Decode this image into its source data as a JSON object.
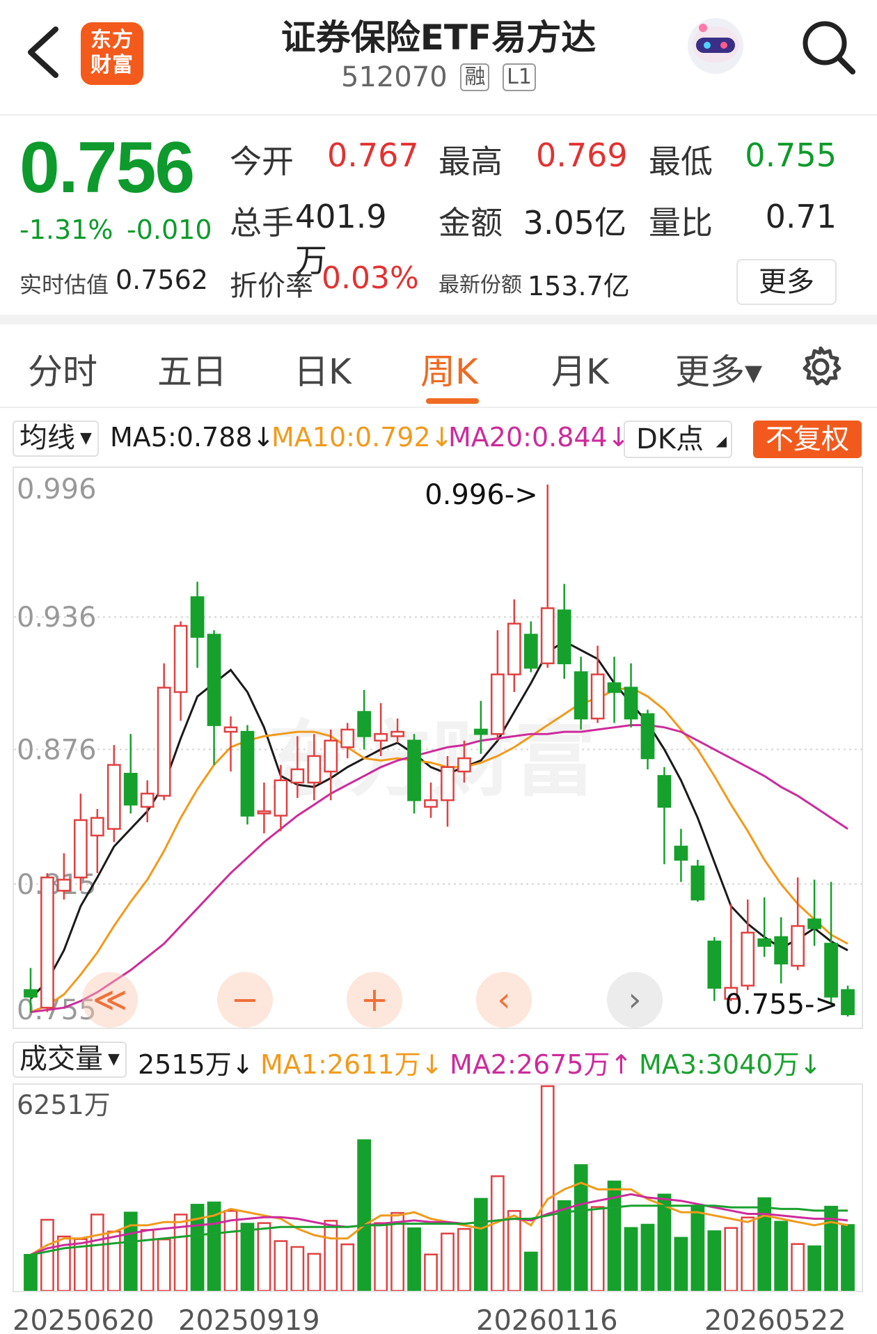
{
  "header": {
    "logo_text_line1": "东方",
    "logo_text_line2": "财富",
    "title": "证券保险ETF易方达",
    "code": "512070",
    "tag_margin": "融",
    "tag_level": "L1"
  },
  "quote": {
    "price": "0.756",
    "change_pct": "-1.31%",
    "change_abs": "-0.010",
    "open_label": "今开",
    "open": "0.767",
    "high_label": "最高",
    "high": "0.769",
    "low_label": "最低",
    "low": "0.755",
    "volume_label": "总手",
    "volume": "401.9万",
    "amount_label": "金额",
    "amount": "3.05亿",
    "vol_ratio_label": "量比",
    "vol_ratio": "0.71",
    "iopv_label": "实时估值",
    "iopv": "0.7562",
    "discount_label": "折价率",
    "discount": "0.03%",
    "shares_label": "最新份额",
    "shares": "153.7亿",
    "more_label": "更多"
  },
  "tabs": {
    "items": [
      "分时",
      "五日",
      "日K",
      "周K",
      "月K",
      "更多▾"
    ],
    "active": "周K"
  },
  "ma_bar": {
    "selector": "均线",
    "ma5": "MA5:0.788↓",
    "ma10": "MA10:0.792↓",
    "ma20": "MA20:0.844↓",
    "dk": "DK点",
    "fq": "不复权",
    "colors": {
      "ma5": "#1a1a1a",
      "ma10": "#f19a1b",
      "ma20": "#cc2b9b"
    }
  },
  "vol_bar": {
    "selector": "成交量",
    "vol": "2515万↓",
    "ma1": "MA1:2611万↓",
    "ma2": "MA2:2675万↑",
    "ma3": "MA3:3040万↓",
    "colors": {
      "ma1": "#f19a1b",
      "ma2": "#cc2b9b",
      "ma3": "#1aa12f"
    }
  },
  "chart_data": {
    "type": "candlestick",
    "y_ticks": [
      "0.996",
      "0.936",
      "0.876",
      "0.815",
      "0.755"
    ],
    "ylim": [
      0.755,
      0.996
    ],
    "max_label": "0.996->",
    "min_label": "0.755->",
    "watermark": "东方财富",
    "candles": [
      {
        "o": 0.767,
        "c": 0.764,
        "h": 0.777,
        "l": 0.757
      },
      {
        "o": 0.759,
        "c": 0.818,
        "h": 0.82,
        "l": 0.757
      },
      {
        "o": 0.812,
        "c": 0.817,
        "h": 0.829,
        "l": 0.808
      },
      {
        "o": 0.818,
        "c": 0.844,
        "h": 0.856,
        "l": 0.812
      },
      {
        "o": 0.837,
        "c": 0.845,
        "h": 0.849,
        "l": 0.82
      },
      {
        "o": 0.84,
        "c": 0.869,
        "h": 0.878,
        "l": 0.834
      },
      {
        "o": 0.865,
        "c": 0.851,
        "h": 0.883,
        "l": 0.847
      },
      {
        "o": 0.85,
        "c": 0.856,
        "h": 0.862,
        "l": 0.843
      },
      {
        "o": 0.855,
        "c": 0.904,
        "h": 0.915,
        "l": 0.853
      },
      {
        "o": 0.902,
        "c": 0.932,
        "h": 0.934,
        "l": 0.889
      },
      {
        "o": 0.945,
        "c": 0.927,
        "h": 0.952,
        "l": 0.913
      },
      {
        "o": 0.928,
        "c": 0.887,
        "h": 0.93,
        "l": 0.869
      },
      {
        "o": 0.884,
        "c": 0.886,
        "h": 0.891,
        "l": 0.866
      },
      {
        "o": 0.884,
        "c": 0.846,
        "h": 0.887,
        "l": 0.842
      },
      {
        "o": 0.847,
        "c": 0.848,
        "h": 0.861,
        "l": 0.838
      },
      {
        "o": 0.846,
        "c": 0.862,
        "h": 0.869,
        "l": 0.839
      },
      {
        "o": 0.861,
        "c": 0.867,
        "h": 0.882,
        "l": 0.854
      },
      {
        "o": 0.861,
        "c": 0.873,
        "h": 0.883,
        "l": 0.853
      },
      {
        "o": 0.866,
        "c": 0.88,
        "h": 0.885,
        "l": 0.853
      },
      {
        "o": 0.877,
        "c": 0.885,
        "h": 0.888,
        "l": 0.872
      },
      {
        "o": 0.893,
        "c": 0.882,
        "h": 0.903,
        "l": 0.876
      },
      {
        "o": 0.88,
        "c": 0.883,
        "h": 0.897,
        "l": 0.873
      },
      {
        "o": 0.882,
        "c": 0.884,
        "h": 0.89,
        "l": 0.879
      },
      {
        "o": 0.88,
        "c": 0.853,
        "h": 0.883,
        "l": 0.847
      },
      {
        "o": 0.85,
        "c": 0.853,
        "h": 0.861,
        "l": 0.845
      },
      {
        "o": 0.853,
        "c": 0.868,
        "h": 0.873,
        "l": 0.841
      },
      {
        "o": 0.866,
        "c": 0.872,
        "h": 0.88,
        "l": 0.861
      },
      {
        "o": 0.885,
        "c": 0.883,
        "h": 0.898,
        "l": 0.874
      },
      {
        "o": 0.883,
        "c": 0.91,
        "h": 0.93,
        "l": 0.88
      },
      {
        "o": 0.91,
        "c": 0.933,
        "h": 0.944,
        "l": 0.902
      },
      {
        "o": 0.928,
        "c": 0.913,
        "h": 0.934,
        "l": 0.911
      },
      {
        "o": 0.915,
        "c": 0.94,
        "h": 0.996,
        "l": 0.913
      },
      {
        "o": 0.939,
        "c": 0.915,
        "h": 0.951,
        "l": 0.908
      },
      {
        "o": 0.911,
        "c": 0.89,
        "h": 0.918,
        "l": 0.885
      },
      {
        "o": 0.89,
        "c": 0.91,
        "h": 0.923,
        "l": 0.888
      },
      {
        "o": 0.906,
        "c": 0.902,
        "h": 0.918,
        "l": 0.888
      },
      {
        "o": 0.904,
        "c": 0.89,
        "h": 0.915,
        "l": 0.886
      },
      {
        "o": 0.892,
        "c": 0.872,
        "h": 0.894,
        "l": 0.867
      },
      {
        "o": 0.864,
        "c": 0.85,
        "h": 0.868,
        "l": 0.824
      },
      {
        "o": 0.832,
        "c": 0.826,
        "h": 0.84,
        "l": 0.816
      },
      {
        "o": 0.823,
        "c": 0.808,
        "h": 0.826,
        "l": 0.807
      },
      {
        "o": 0.789,
        "c": 0.768,
        "h": 0.791,
        "l": 0.762
      },
      {
        "o": 0.763,
        "c": 0.768,
        "h": 0.806,
        "l": 0.762
      },
      {
        "o": 0.769,
        "c": 0.793,
        "h": 0.808,
        "l": 0.767
      },
      {
        "o": 0.79,
        "c": 0.787,
        "h": 0.809,
        "l": 0.782
      },
      {
        "o": 0.791,
        "c": 0.779,
        "h": 0.8,
        "l": 0.77
      },
      {
        "o": 0.778,
        "c": 0.796,
        "h": 0.818,
        "l": 0.776
      },
      {
        "o": 0.799,
        "c": 0.795,
        "h": 0.817,
        "l": 0.787
      },
      {
        "o": 0.788,
        "c": 0.764,
        "h": 0.816,
        "l": 0.761
      },
      {
        "o": 0.767,
        "c": 0.756,
        "h": 0.769,
        "l": 0.755
      }
    ],
    "series": [
      {
        "name": "MA5",
        "values": [
          0.763,
          0.771,
          0.785,
          0.805,
          0.818,
          0.832,
          0.84,
          0.848,
          0.86,
          0.881,
          0.9,
          0.906,
          0.912,
          0.902,
          0.886,
          0.864,
          0.86,
          0.859,
          0.863,
          0.868,
          0.872,
          0.876,
          0.879,
          0.874,
          0.868,
          0.865,
          0.868,
          0.871,
          0.88,
          0.893,
          0.906,
          0.92,
          0.925,
          0.921,
          0.917,
          0.906,
          0.897,
          0.888,
          0.876,
          0.862,
          0.845,
          0.825,
          0.805,
          0.797,
          0.791,
          0.786,
          0.79,
          0.795,
          0.789,
          0.785
        ]
      },
      {
        "name": "MA10",
        "values": [
          0.757,
          0.76,
          0.765,
          0.774,
          0.784,
          0.796,
          0.807,
          0.817,
          0.83,
          0.845,
          0.858,
          0.869,
          0.877,
          0.88,
          0.882,
          0.883,
          0.884,
          0.884,
          0.882,
          0.877,
          0.872,
          0.871,
          0.872,
          0.871,
          0.87,
          0.868,
          0.868,
          0.87,
          0.873,
          0.877,
          0.882,
          0.887,
          0.892,
          0.897,
          0.899,
          0.903,
          0.904,
          0.9,
          0.894,
          0.885,
          0.876,
          0.864,
          0.851,
          0.839,
          0.826,
          0.815,
          0.806,
          0.799,
          0.792,
          0.788
        ]
      },
      {
        "name": "MA20",
        "values": [
          0.757,
          0.758,
          0.759,
          0.762,
          0.766,
          0.771,
          0.776,
          0.782,
          0.788,
          0.796,
          0.804,
          0.812,
          0.82,
          0.827,
          0.834,
          0.84,
          0.846,
          0.851,
          0.856,
          0.86,
          0.864,
          0.868,
          0.871,
          0.873,
          0.875,
          0.877,
          0.878,
          0.88,
          0.881,
          0.882,
          0.883,
          0.883,
          0.884,
          0.884,
          0.885,
          0.886,
          0.887,
          0.887,
          0.886,
          0.884,
          0.88,
          0.876,
          0.872,
          0.868,
          0.864,
          0.859,
          0.855,
          0.85,
          0.845,
          0.84
        ]
      }
    ],
    "volume": {
      "max_label": "6251万",
      "ymax": 6251,
      "dates": [
        "20250620",
        "20250919",
        "20260116",
        "20260522"
      ],
      "values": [
        1100,
        2170,
        1660,
        1580,
        2330,
        1810,
        2390,
        1860,
        1570,
        2330,
        2630,
        2700,
        2440,
        2050,
        2070,
        1520,
        1340,
        1130,
        2140,
        1420,
        4600,
        2070,
        2380,
        1910,
        1110,
        1750,
        1890,
        2810,
        3500,
        2440,
        1170,
        6251,
        2740,
        3840,
        2560,
        3340,
        1920,
        2020,
        2940,
        1620,
        2550,
        1820,
        1920,
        2240,
        2830,
        2110,
        1430,
        1360,
        2570,
        2010
      ],
      "ma1": [
        1100,
        1400,
        1600,
        1600,
        1700,
        1800,
        2000,
        2000,
        2100,
        2100,
        2200,
        2300,
        2500,
        2400,
        2300,
        2200,
        1900,
        1700,
        1600,
        1600,
        2000,
        2300,
        2300,
        2400,
        2200,
        2100,
        2000,
        1900,
        2100,
        2300,
        2000,
        2800,
        3100,
        3300,
        3100,
        3100,
        3100,
        2800,
        2600,
        2400,
        2400,
        2300,
        2200,
        2100,
        2300,
        2200,
        2100,
        2000,
        2100,
        2000
      ],
      "ma2": [
        1100,
        1300,
        1400,
        1450,
        1550,
        1650,
        1750,
        1850,
        1900,
        1950,
        2000,
        2050,
        2150,
        2200,
        2250,
        2250,
        2200,
        2100,
        2000,
        1950,
        2000,
        2050,
        2100,
        2150,
        2100,
        2100,
        2050,
        2100,
        2150,
        2200,
        2150,
        2350,
        2500,
        2650,
        2750,
        2850,
        2950,
        2850,
        2800,
        2750,
        2650,
        2550,
        2450,
        2350,
        2350,
        2300,
        2250,
        2200,
        2200,
        2150
      ],
      "ma3": [
        1100,
        1200,
        1300,
        1350,
        1400,
        1450,
        1500,
        1550,
        1600,
        1650,
        1700,
        1750,
        1800,
        1850,
        1900,
        1950,
        1950,
        1950,
        1950,
        1950,
        2000,
        2000,
        2050,
        2050,
        2050,
        2050,
        2050,
        2100,
        2150,
        2200,
        2200,
        2300,
        2400,
        2450,
        2500,
        2550,
        2600,
        2600,
        2600,
        2600,
        2600,
        2600,
        2550,
        2550,
        2550,
        2500,
        2500,
        2450,
        2450,
        2450
      ]
    }
  }
}
